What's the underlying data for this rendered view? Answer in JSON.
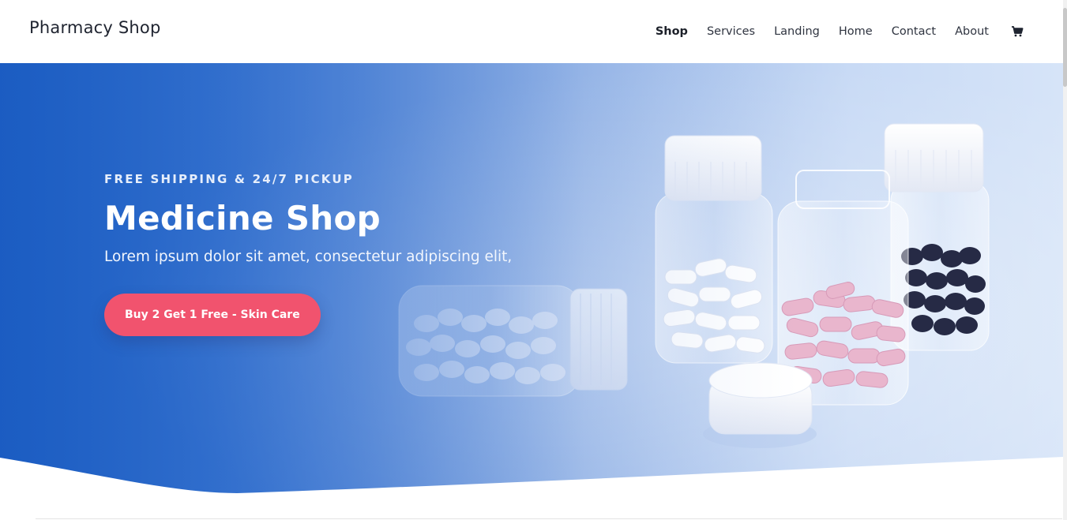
{
  "header": {
    "logo": "Pharmacy Shop",
    "nav": [
      {
        "label": "Shop",
        "active": true
      },
      {
        "label": "Services",
        "active": false
      },
      {
        "label": "Landing",
        "active": false
      },
      {
        "label": "Home",
        "active": false
      },
      {
        "label": "Contact",
        "active": false
      },
      {
        "label": "About",
        "active": false
      }
    ],
    "cart_icon": "shopping-cart-icon"
  },
  "hero": {
    "eyebrow": "FREE SHIPPING & 24/7 PICKUP",
    "title": "Medicine Shop",
    "subtitle": "Lorem ipsum dolor sit amet, consectetur adipiscing elit,",
    "cta": "Buy 2 Get 1 Free - Skin Care"
  },
  "colors": {
    "accent": "#f1536e",
    "hero_blue": "#1c5fc3",
    "text_dark": "#1f2430"
  }
}
